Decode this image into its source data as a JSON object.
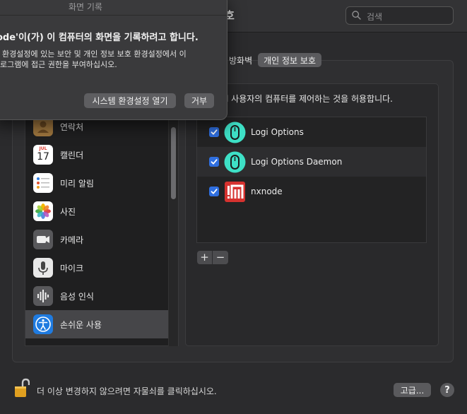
{
  "window": {
    "title_tail": "호",
    "search_placeholder": "검색"
  },
  "tabs": [
    {
      "label": "방화벽",
      "selected": false
    },
    {
      "label": "개인 정보 보호",
      "selected": true
    }
  ],
  "sidebar": {
    "items": [
      {
        "label": "연락처",
        "icon": "contacts-icon"
      },
      {
        "label": "캘린더",
        "icon": "calendar-icon",
        "icon_month": "JUL",
        "icon_day": "17"
      },
      {
        "label": "미리 알림",
        "icon": "reminders-icon"
      },
      {
        "label": "사진",
        "icon": "photos-icon"
      },
      {
        "label": "카메라",
        "icon": "camera-icon"
      },
      {
        "label": "마이크",
        "icon": "microphone-icon"
      },
      {
        "label": "음성 인식",
        "icon": "speech-recognition-icon"
      },
      {
        "label": "손쉬운 사용",
        "icon": "accessibility-icon",
        "selected": true
      }
    ]
  },
  "main": {
    "description": "l 사용자의 컴퓨터를 제어하는 것을 허용합니다.",
    "apps": [
      {
        "name": "Logi Options",
        "checked": true,
        "icon": "logi-options-icon"
      },
      {
        "name": "Logi Options Daemon",
        "checked": true,
        "icon": "logi-options-daemon-icon"
      },
      {
        "name": "nxnode",
        "checked": true,
        "icon": "nxnode-icon"
      }
    ],
    "add_label": "+",
    "remove_label": "−"
  },
  "footer": {
    "lock_text": "더 이상 변경하지 않으려면 자물쇠를 클릭하십시오.",
    "advanced_label": "고급...",
    "help_label": "?"
  },
  "dialog": {
    "title": "화면 기록",
    "heading": "ode'이(가) 이 컴퓨터의 화면을 기록하려고 합니다.",
    "body_line1": "환경설정에 있는 보안 및 개인 정보 보호 환경설정에서 이",
    "body_line2": "로그램에 접근 권한을 부여하십시오.",
    "open_button": "시스템 환경설정 열기",
    "deny_button": "거부"
  },
  "colors": {
    "accent": "#2f6fe0",
    "logi_teal": "#3ee0c6",
    "nxnode_red": "#d6322f"
  }
}
